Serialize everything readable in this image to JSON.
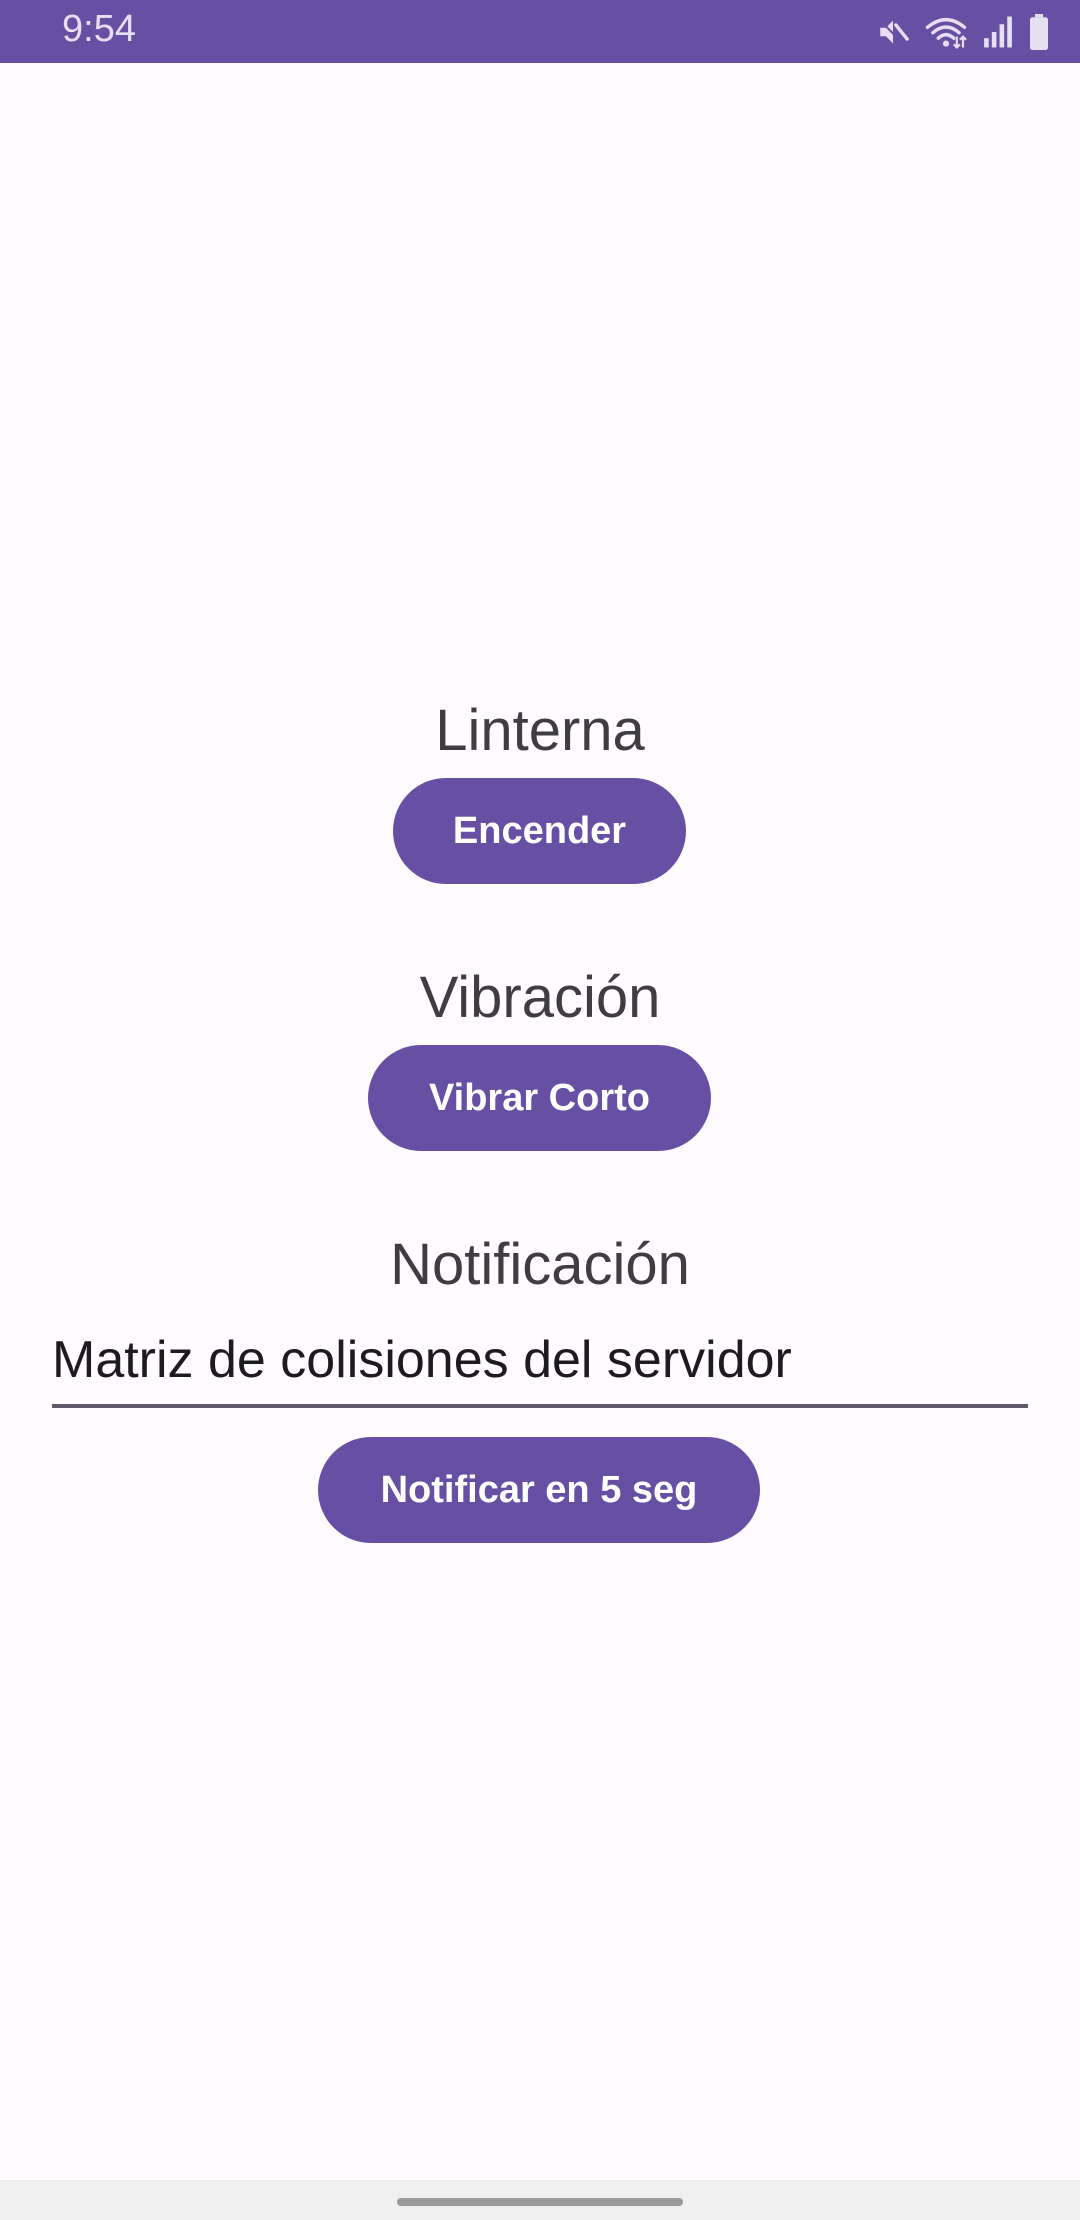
{
  "status_bar": {
    "time": "9:54",
    "icons": [
      "mute-icon",
      "wifi-icon",
      "signal-icon",
      "battery-icon"
    ],
    "color": "#6750a4"
  },
  "flashlight": {
    "title": "Linterna",
    "button_label": "Encender"
  },
  "vibration": {
    "title": "Vibración",
    "button_label": "Vibrar Corto"
  },
  "notification": {
    "title": "Notificación",
    "input_value": "Matriz de colisiones del servidor",
    "button_label": "Notificar en 5 seg"
  },
  "theme": {
    "accent": "#6750a4",
    "background": "#fffbfe",
    "title_text": "#3f3d44"
  }
}
